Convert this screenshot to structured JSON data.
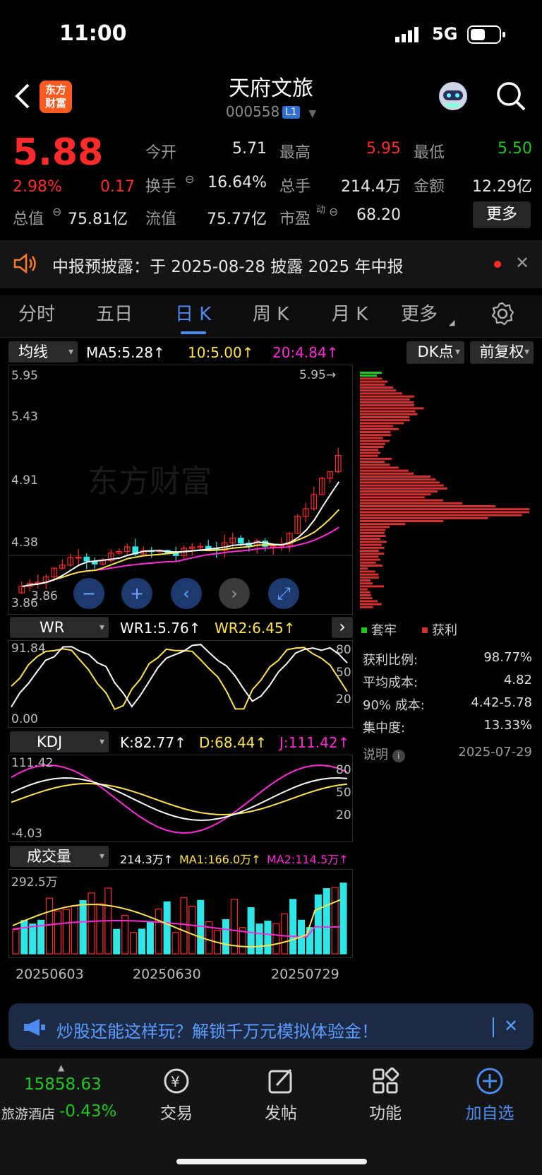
{
  "status": {
    "time": "11:00",
    "network": "5G"
  },
  "header": {
    "name": "天府文旅",
    "code": "000558",
    "level": "L1",
    "logo": "东方\n财富",
    "logo_line1": "东方",
    "logo_line2": "财富"
  },
  "quote": {
    "price": "5.88",
    "change_pct": "2.98%",
    "change": "0.17",
    "open_label": "今开",
    "open": "5.71",
    "high_label": "最高",
    "high": "5.95",
    "low_label": "最低",
    "low": "5.50",
    "turnover_label": "换手",
    "turnover": "16.64%",
    "volume_label": "总手",
    "volume": "214.4万",
    "amount_label": "金额",
    "amount": "12.29亿",
    "mktcap_label": "总值",
    "mktcap": "75.81亿",
    "float_label": "流值",
    "float": "75.77亿",
    "pe_label": "市盈",
    "pe_sup": "动",
    "pe": "68.20",
    "more": "更多"
  },
  "notice": {
    "text": "中报预披露：于 2025-08-28 披露 2025 年中报"
  },
  "tabs": [
    "分时",
    "五日",
    "日 K",
    "周 K",
    "月 K",
    "更多"
  ],
  "main_chart": {
    "selector": "均线",
    "ma5": "MA5:5.28↑",
    "ma10": "10:5.00↑",
    "ma20": "20:4.84↑",
    "dk": "DK点",
    "adjust": "前复权",
    "y_labels": [
      "5.95",
      "5.43",
      "4.91",
      "4.38",
      "3.86"
    ],
    "high_marker": "5.95→",
    "low_marker": "3.86",
    "watermark": "东方财富"
  },
  "wr": {
    "selector": "WR",
    "wr1": "WR1:5.76↑",
    "wr2": "WR2:6.45↑",
    "top": "91.84",
    "bottom": "0.00",
    "levels": [
      "80",
      "50",
      "20"
    ]
  },
  "kdj": {
    "selector": "KDJ",
    "k": "K:82.77↑",
    "d": "D:68.44↑",
    "j": "J:111.42↑",
    "top": "111.42",
    "bottom": "-4.03",
    "levels": [
      "80",
      "50",
      "20"
    ]
  },
  "vol": {
    "selector": "成交量",
    "v": "214.3万↑",
    "ma1": "MA1:166.0万↑",
    "ma2": "MA2:114.5万↑",
    "top": "292.5万",
    "dates": [
      "20250603",
      "20250630",
      "20250729"
    ]
  },
  "chips": {
    "legend_trap": "套牢",
    "legend_profit": "获利",
    "rows": [
      {
        "label": "获利比例:",
        "value": "98.77%"
      },
      {
        "label": "平均成本:",
        "value": "4.82"
      },
      {
        "label": "90% 成本:",
        "value": "4.42-5.78"
      },
      {
        "label": "集中度:",
        "value": "13.33%"
      }
    ],
    "note": "说明",
    "date": "2025-07-29"
  },
  "ad": {
    "text": "炒股还能这样玩？解锁千万元模拟体验金！"
  },
  "bottom": {
    "index_value": "15858.63",
    "index_name": "旅游酒店",
    "index_change": "-0.43%",
    "trade": "交易",
    "post": "发帖",
    "func": "功能",
    "add": "加自选"
  },
  "colors": {
    "up": "#ff2a2a",
    "down": "#1ec81e",
    "accent": "#4d8bf0",
    "ma10": "#ffe34d",
    "ma20": "#ff2bd6"
  }
}
